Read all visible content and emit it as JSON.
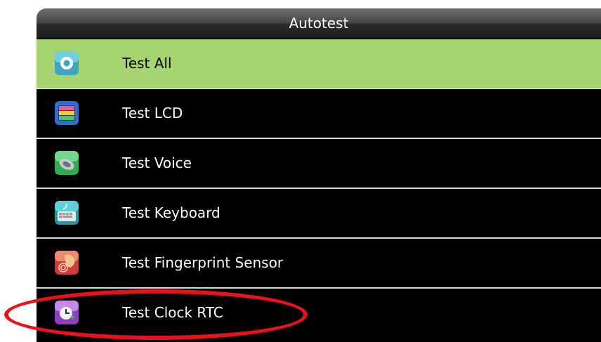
{
  "header": {
    "title": "Autotest"
  },
  "menu": {
    "items": [
      {
        "label": "Test All",
        "icon": "test-all-icon",
        "selected": true
      },
      {
        "label": "Test LCD",
        "icon": "lcd-icon",
        "selected": false
      },
      {
        "label": "Test Voice",
        "icon": "speaker-icon",
        "selected": false
      },
      {
        "label": "Test Keyboard",
        "icon": "keyboard-icon",
        "selected": false
      },
      {
        "label": "Test Fingerprint Sensor",
        "icon": "fingerprint-icon",
        "selected": false
      },
      {
        "label": "Test Clock RTC",
        "icon": "clock-icon",
        "selected": false
      }
    ]
  },
  "colors": {
    "selected_bg": "#a6d56f",
    "screen_bg": "#000000",
    "annotation": "#e8121c"
  }
}
